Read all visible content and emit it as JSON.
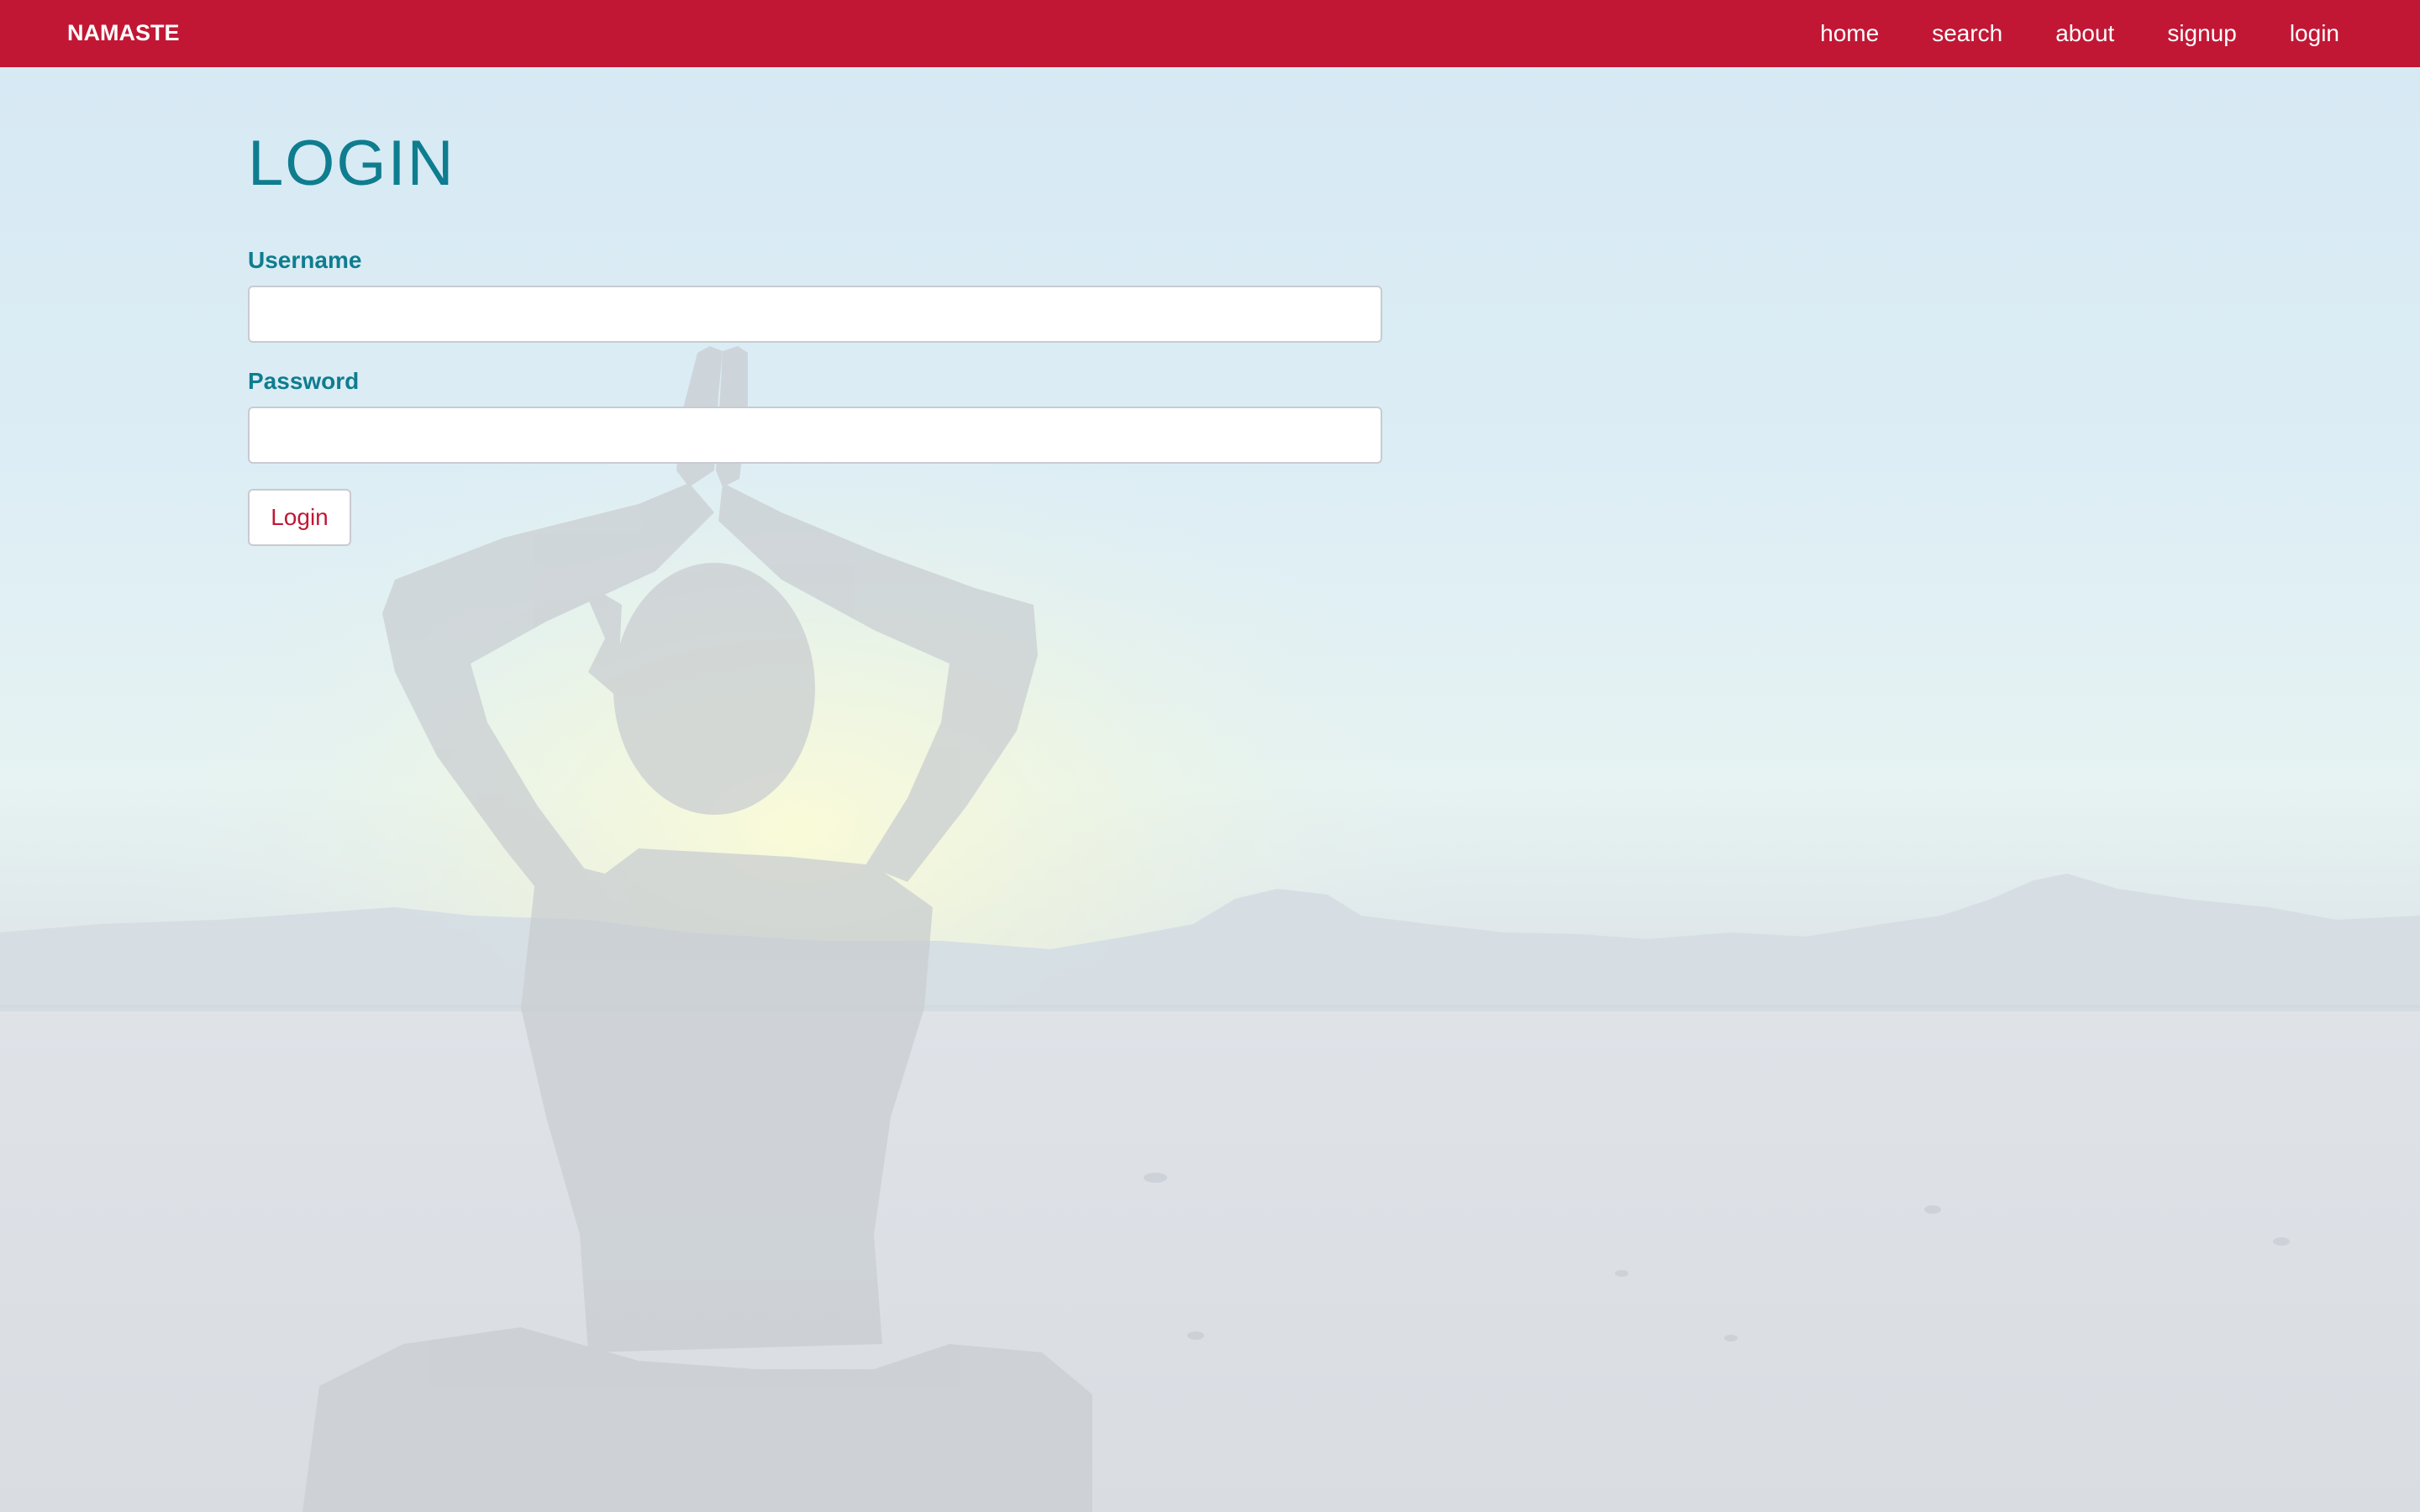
{
  "navbar": {
    "brand": "NAMASTE",
    "links": [
      {
        "label": "home"
      },
      {
        "label": "search"
      },
      {
        "label": "about"
      },
      {
        "label": "signup"
      },
      {
        "label": "login"
      }
    ],
    "background_color": "#c11735"
  },
  "main": {
    "title": "LOGIN",
    "username": {
      "label": "Username",
      "value": "",
      "placeholder": ""
    },
    "password": {
      "label": "Password",
      "value": "",
      "placeholder": ""
    },
    "submit_label": "Login"
  },
  "colors": {
    "accent": "#0e7d8f",
    "brand": "#c11735"
  },
  "background": {
    "image_subject": "person meditating with arms raised facing a mountain horizon and sun"
  }
}
